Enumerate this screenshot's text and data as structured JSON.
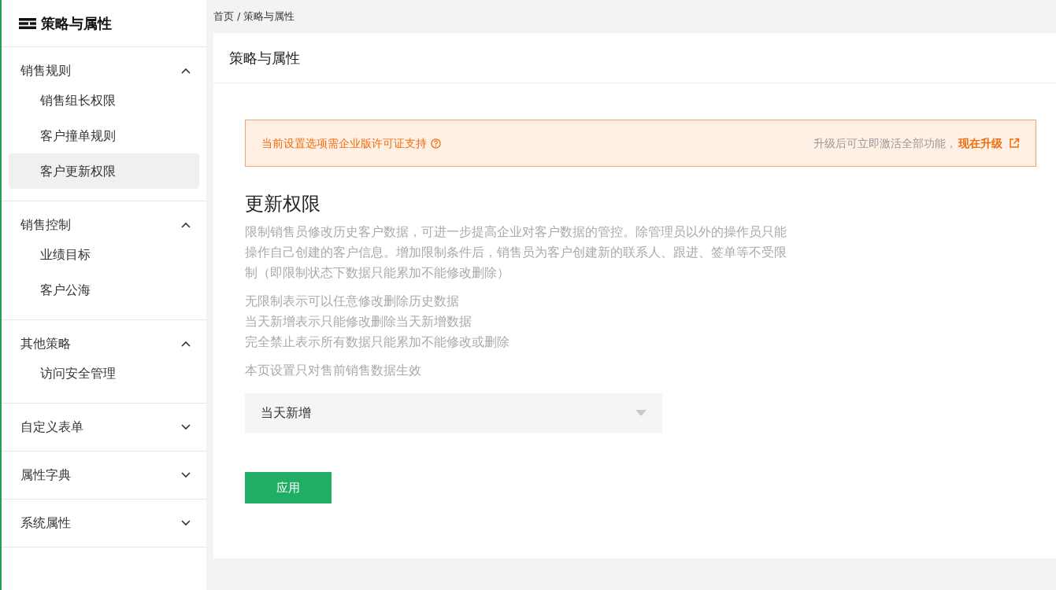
{
  "sidebar": {
    "title": "策略与属性",
    "groups": [
      {
        "label": "销售规则",
        "expanded": true,
        "items": [
          {
            "label": "销售组长权限",
            "selected": false
          },
          {
            "label": "客户撞单规则",
            "selected": false
          },
          {
            "label": "客户更新权限",
            "selected": true
          }
        ]
      },
      {
        "label": "销售控制",
        "expanded": true,
        "items": [
          {
            "label": "业绩目标",
            "selected": false
          },
          {
            "label": "客户公海",
            "selected": false
          }
        ]
      },
      {
        "label": "其他策略",
        "expanded": true,
        "items": [
          {
            "label": "访问安全管理",
            "selected": false
          }
        ]
      },
      {
        "label": "自定义表单",
        "expanded": false
      },
      {
        "label": "属性字典",
        "expanded": false
      },
      {
        "label": "系统属性",
        "expanded": false
      }
    ]
  },
  "breadcrumb": [
    "首页",
    "/",
    "策略与属性"
  ],
  "page_title": "策略与属性",
  "notice": {
    "text": "当前设置选项需企业版许可证支持",
    "hint": "升级后可立即激活全部功能，",
    "link": "现在升级"
  },
  "section": {
    "title": "更新权限",
    "description": "限制销售员修改历史客户数据，可进一步提高企业对客户数据的管控。除管理员以外的操作员只能操作自己创建的客户信息。增加限制条件后，销售员为客户创建新的联系人、跟进、签单等不受限制（即限制状态下数据只能累加不能修改删除）",
    "options_help": [
      "无限制表示可以任意修改删除历史数据",
      "当天新增表示只能修改删除当天新增数据",
      "完全禁止表示所有数据只能累加不能修改或删除"
    ],
    "scope_note": "本页设置只对售前销售数据生效"
  },
  "select": {
    "value": "当天新增"
  },
  "apply_button": "应用"
}
